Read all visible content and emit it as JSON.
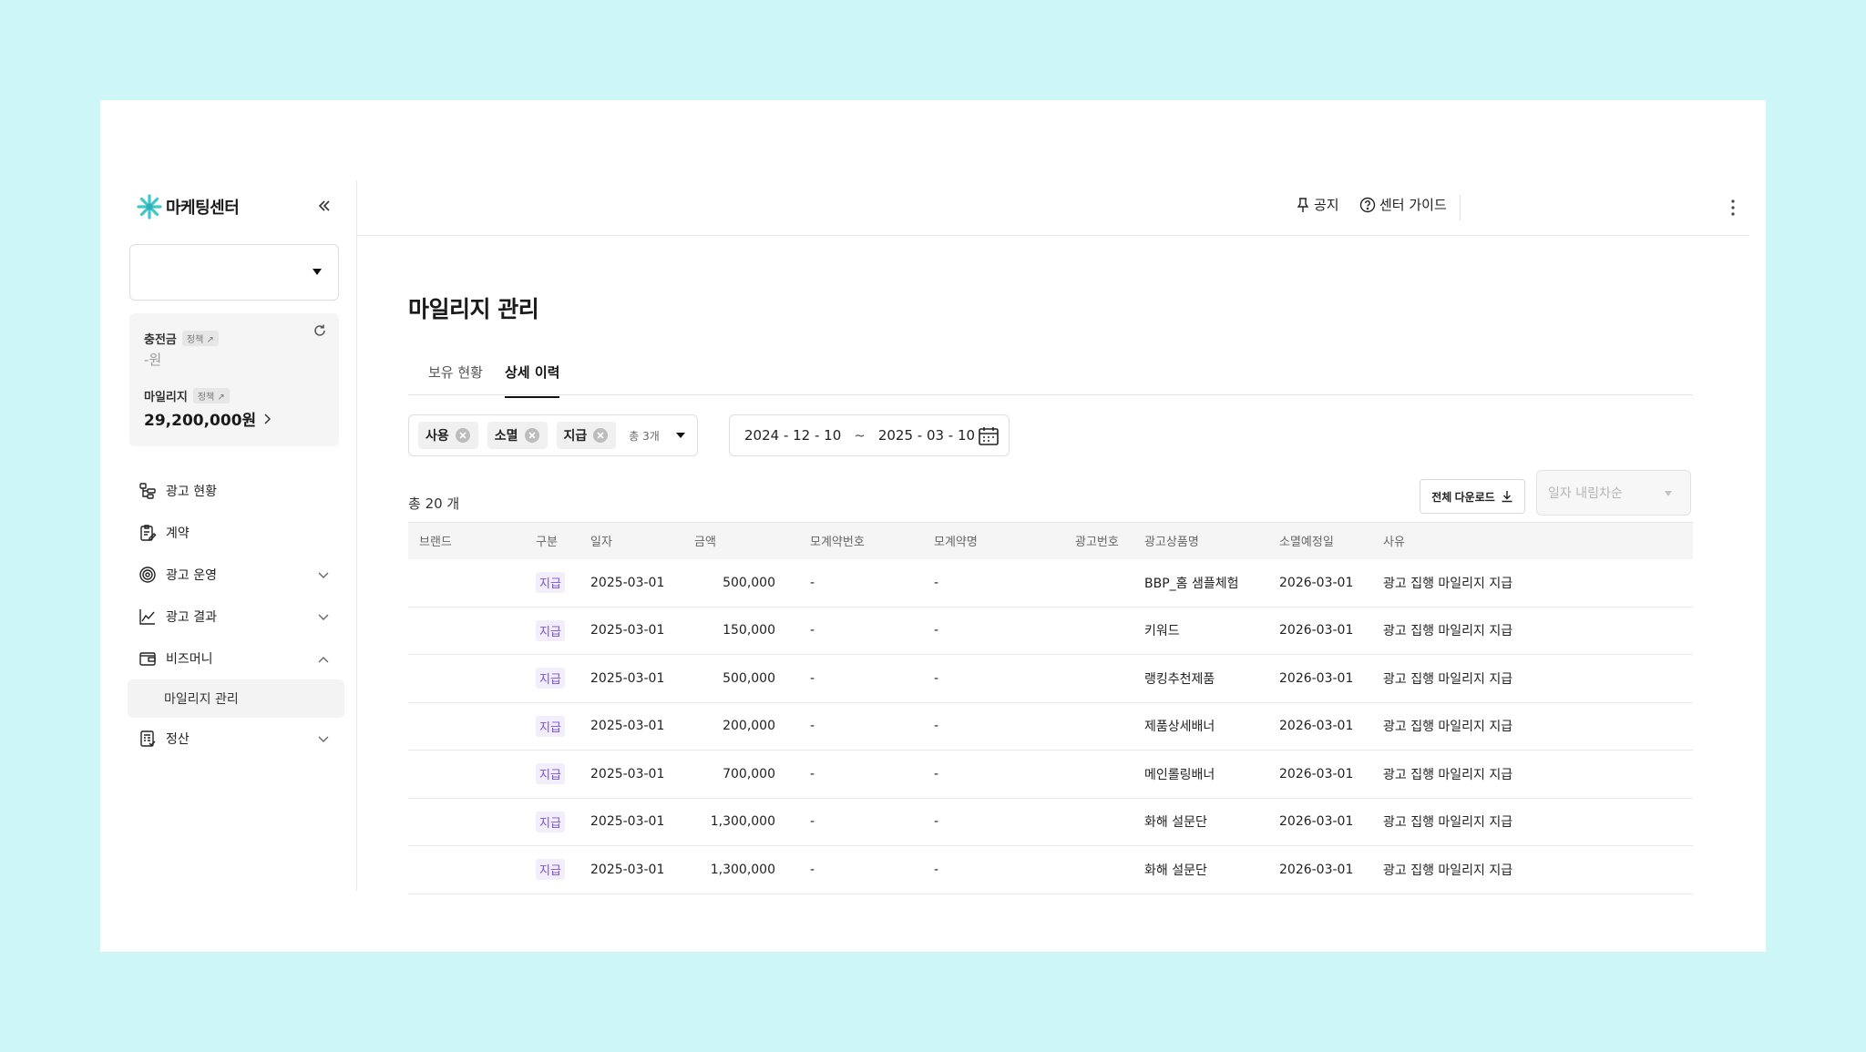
{
  "brand": {
    "name": "마케팅센터"
  },
  "balance": {
    "charge_label": "충전금",
    "charge_value": "-원",
    "mileage_label": "마일리지",
    "mileage_value": "29,200,000원",
    "policy_tag": "정책 ↗"
  },
  "nav": {
    "items": [
      {
        "label": "광고 현황",
        "icon": "ad-status-icon"
      },
      {
        "label": "계약",
        "icon": "contract-icon"
      },
      {
        "label": "광고 운영",
        "icon": "target-icon"
      },
      {
        "label": "광고 결과",
        "icon": "line-chart-icon"
      },
      {
        "label": "비즈머니",
        "icon": "wallet-icon"
      },
      {
        "label": "정산",
        "icon": "settlement-icon"
      }
    ],
    "sub_item": "마일리지 관리"
  },
  "header": {
    "notice": "공지",
    "guide": "센터 가이드"
  },
  "page": {
    "title": "마일리지 관리",
    "tabs": [
      "보유 현황",
      "상세 이력"
    ],
    "active_tab": "상세 이력"
  },
  "filters": {
    "chips": [
      "사용",
      "소멸",
      "지급"
    ],
    "count": "총 3개",
    "date_from": "2024 - 12 - 10",
    "date_sep": "~",
    "date_to": "2025 - 03 - 10"
  },
  "toolbar": {
    "total": "총 20 개",
    "download": "전체 다운로드",
    "sort": "일자 내림차순"
  },
  "table": {
    "columns": [
      "브랜드",
      "구분",
      "일자",
      "금액",
      "모계약번호",
      "모계약명",
      "광고번호",
      "광고상품명",
      "소멸예정일",
      "사유"
    ],
    "rows": [
      [
        "",
        "지급",
        "2025-03-01",
        "500,000",
        "-",
        "-",
        "",
        "BBP_홈 샘플체험",
        "2026-03-01",
        "광고 집행 마일리지 지급"
      ],
      [
        "",
        "지급",
        "2025-03-01",
        "150,000",
        "-",
        "-",
        "",
        "키워드",
        "2026-03-01",
        "광고 집행 마일리지 지급"
      ],
      [
        "",
        "지급",
        "2025-03-01",
        "500,000",
        "-",
        "-",
        "",
        "랭킹추천제품",
        "2026-03-01",
        "광고 집행 마일리지 지급"
      ],
      [
        "",
        "지급",
        "2025-03-01",
        "200,000",
        "-",
        "-",
        "",
        "제품상세배너",
        "2026-03-01",
        "광고 집행 마일리지 지급"
      ],
      [
        "",
        "지급",
        "2025-03-01",
        "700,000",
        "-",
        "-",
        "",
        "메인롤링배너",
        "2026-03-01",
        "광고 집행 마일리지 지급"
      ],
      [
        "",
        "지급",
        "2025-03-01",
        "1,300,000",
        "-",
        "-",
        "",
        "화해 설문단",
        "2026-03-01",
        "광고 집행 마일리지 지급"
      ],
      [
        "",
        "지급",
        "2025-03-01",
        "1,300,000",
        "-",
        "-",
        "",
        "화해 설문단",
        "2026-03-01",
        "광고 집행 마일리지 지급"
      ]
    ]
  },
  "colors": {
    "accent": "#7b52d9",
    "brand_logo": "#40c8c8",
    "backdrop": "#cdf7f6"
  }
}
